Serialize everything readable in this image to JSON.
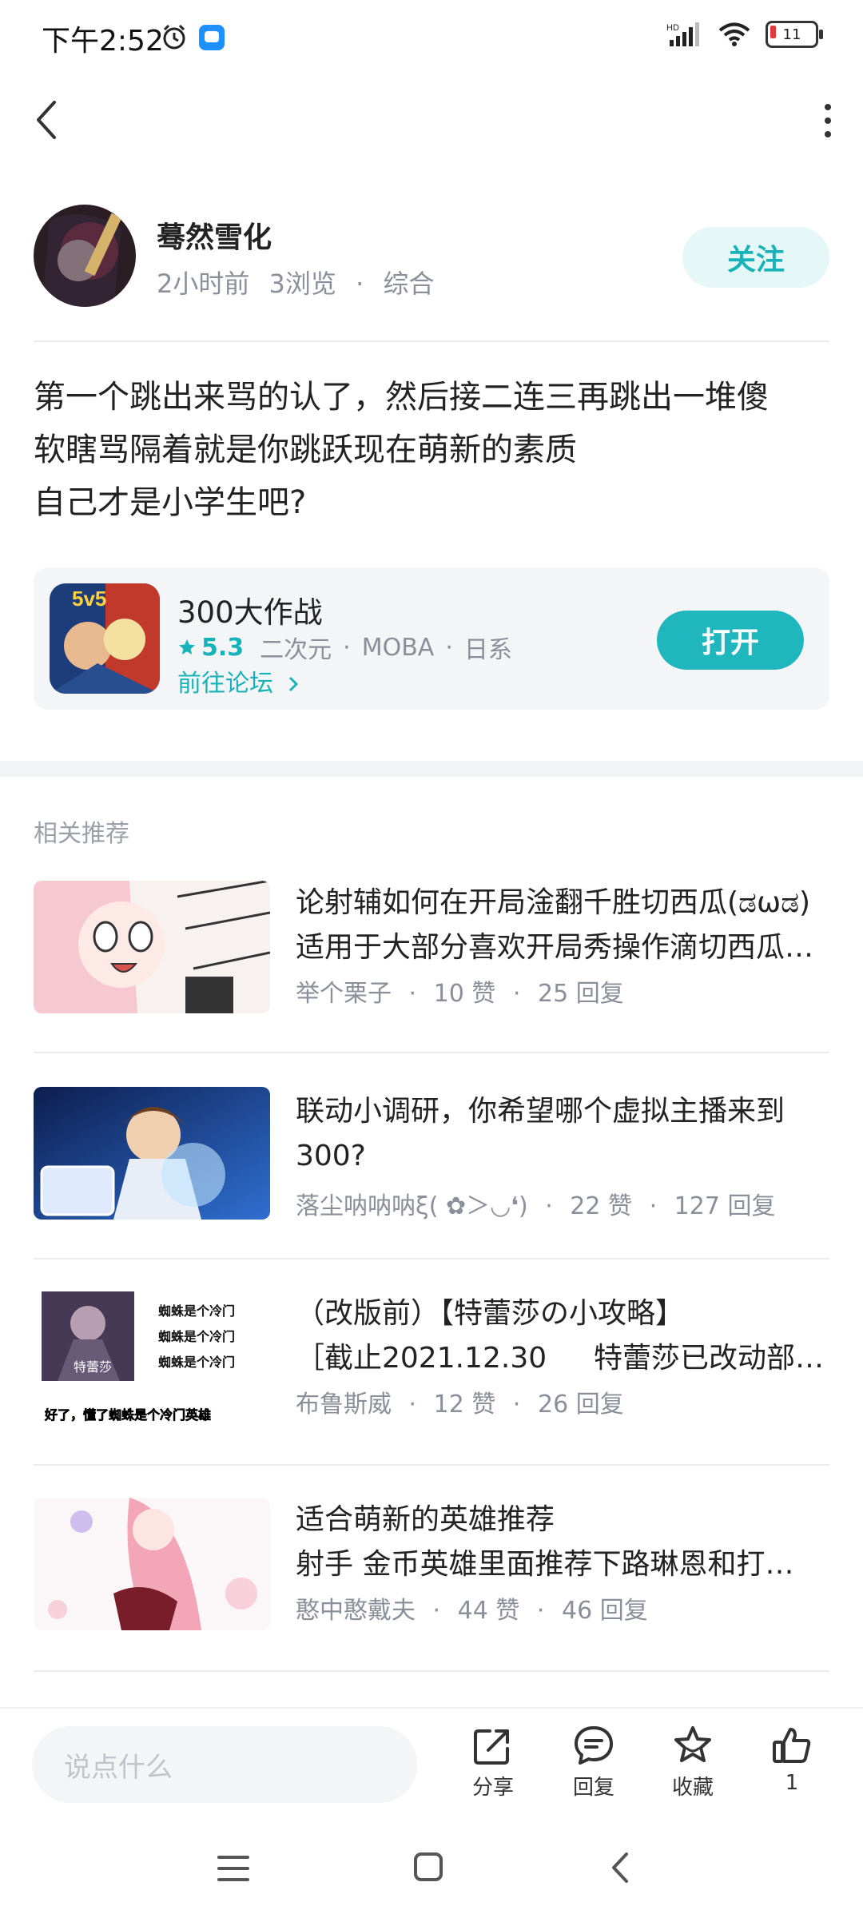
{
  "status_bar": {
    "time": "下午2:52",
    "network": "HD",
    "battery": "11"
  },
  "nav": {
    "back_icon": "back-chevron-icon",
    "more_icon": "more-vertical-icon"
  },
  "author": {
    "name": "蓦然雪化",
    "time": "2小时前",
    "views": "3浏览",
    "dot": "·",
    "category": "综合",
    "follow_label": "关注"
  },
  "post": {
    "lines": [
      "第一个跳出来骂的认了，然后接二连三再跳出一堆傻",
      "软瞎骂隔着就是你跳跃现在萌新的素质",
      "自己才是小学生吧?"
    ]
  },
  "game": {
    "name": "300大作战",
    "badge": "5v5",
    "score": "5.3",
    "tags": [
      "二次元",
      "MOBA",
      "日系"
    ],
    "dot": "·",
    "forum_link": "前往论坛",
    "open_label": "打开"
  },
  "related": {
    "section_title": "相关推荐",
    "items": [
      {
        "title_line1": "论射辅如何在开局淦翻千胜切西瓜(ಡωಡ)",
        "title_line2": "适用于大部分喜欢开局秀操作滴切西瓜…",
        "author": "举个栗子",
        "likes": "10 赞",
        "replies": "25 回复"
      },
      {
        "title_line1": "联动小调研，你希望哪个虚拟主播来到",
        "title_line2": "300?",
        "author": "落尘呐呐呐ξ( ✿＞◡❛)",
        "likes": "22 赞",
        "replies": "127 回复"
      },
      {
        "title_line1": "（改版前）【特蕾莎の小攻略】",
        "title_line2": "［截止2021.12.30 　  特蕾莎已改动部…",
        "author": "布鲁斯威",
        "likes": "12 赞",
        "replies": "26 回复",
        "thumb_texts": [
          "蜘蛛是个冷门",
          "蜘蛛是个冷门",
          "蜘蛛是个冷门",
          "好了，懂了蜘蛛是个冷门英雄",
          "特蕾莎"
        ]
      },
      {
        "title_line1": "适合萌新的英雄推荐",
        "title_line2": "射手 金币英雄里面推荐下路琳恩和打…",
        "author": "憨中憨戴夫",
        "likes": "44 赞",
        "replies": "46 回复"
      }
    ],
    "dot": "·"
  },
  "bottom_bar": {
    "input_placeholder": "说点什么",
    "share_label": "分享",
    "reply_label": "回复",
    "favorite_label": "收藏",
    "like_count": "1"
  },
  "colors": {
    "accent": "#1fb7bd",
    "text": "#222222",
    "muted": "#8a8f99"
  }
}
